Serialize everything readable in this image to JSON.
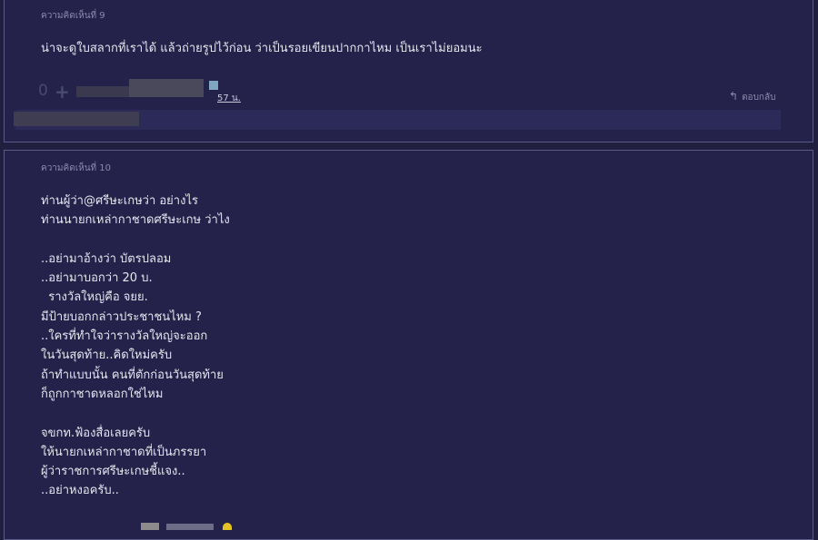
{
  "comments": [
    {
      "number_label": "ความคิดเห็นที่ 9",
      "lines": [
        "น่าจะดูใบสลากที่เราได้ แล้วถ่ายรูปไว้ก่อน ว่าเป็นรอยเขียนปากกาไหม เป็นเราไม่ยอมนะ"
      ],
      "votes": "0",
      "time": "57 น.",
      "reply_label": "ตอบกลับ"
    },
    {
      "number_label": "ความคิดเห็นที่ 10",
      "lines": [
        "ท่านผู้ว่า@ศรีษะเกษว่า อย่างไร",
        "ท่านนายกเหล่ากาชาดศรีษะเกษ ว่าไง",
        "",
        "..อย่ามาอ้างว่า บัตรปลอม",
        "..อย่ามาบอกว่า 20 บ.",
        "  รางวัลใหญ่คือ จยย.",
        "มีป้ายบอกกล่าวประชาชนไหม ?",
        "..ใครที่ทำใจว่ารางวัลใหญ่จะออก",
        "ในวันสุดท้าย..คิดใหม่ครับ",
        "ถ้าทำแบบนั้น คนที่ตักก่อนวันสุดท้าย",
        "ก็ถูกกาชาดหลอกใช่ไหม",
        "",
        "จขกท.ฟ้องสื่อเลยครับ",
        "ให้นายกเหล่ากาชาดที่เป็นภรรยา",
        "ผู้ว่าราชการศรีษะเกษชี้แจง..",
        "..อย่าหงอครับ.."
      ]
    }
  ],
  "colors": {
    "page_bg": "#211f3f",
    "card_bg": "#24224a",
    "card_border": "#5b5a86",
    "text": "#e6e6ee",
    "muted": "#8a89ad"
  }
}
